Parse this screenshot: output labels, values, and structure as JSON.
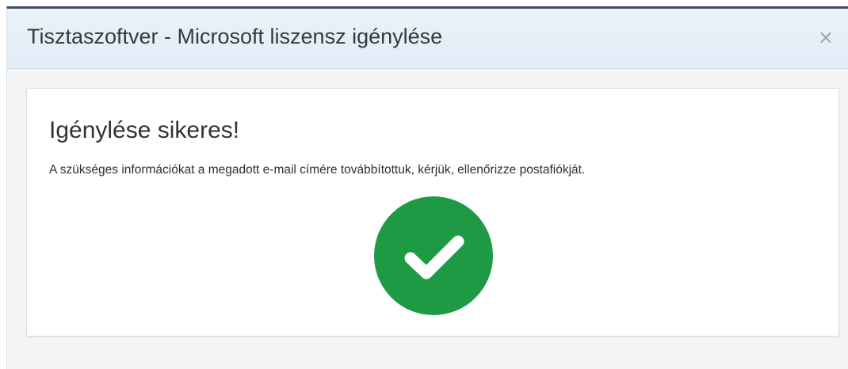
{
  "dialog": {
    "title": "Tisztaszoftver - Microsoft liszensz igénylése",
    "close_label": "×"
  },
  "result": {
    "heading": "Igénylése sikeres!",
    "message": "A szükséges információkat a megadott e-mail címére továbbítottuk, kérjük, ellenőrizze postafiókját.",
    "icon": "check-circle-icon",
    "icon_color": "#1e9a45",
    "icon_check_color": "#ffffff"
  }
}
